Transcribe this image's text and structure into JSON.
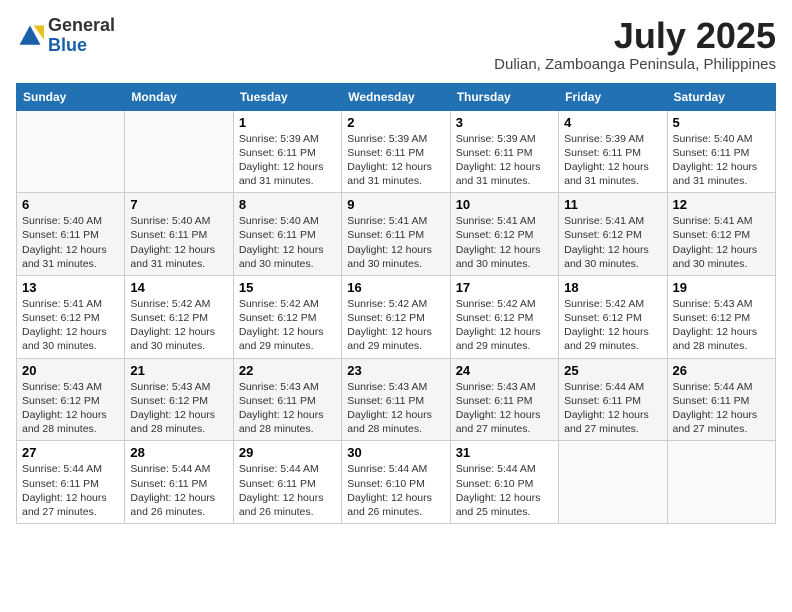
{
  "logo": {
    "general": "General",
    "blue": "Blue"
  },
  "header": {
    "month": "July 2025",
    "location": "Dulian, Zamboanga Peninsula, Philippines"
  },
  "weekdays": [
    "Sunday",
    "Monday",
    "Tuesday",
    "Wednesday",
    "Thursday",
    "Friday",
    "Saturday"
  ],
  "weeks": [
    [
      {
        "day": "",
        "info": ""
      },
      {
        "day": "",
        "info": ""
      },
      {
        "day": "1",
        "info": "Sunrise: 5:39 AM\nSunset: 6:11 PM\nDaylight: 12 hours and 31 minutes."
      },
      {
        "day": "2",
        "info": "Sunrise: 5:39 AM\nSunset: 6:11 PM\nDaylight: 12 hours and 31 minutes."
      },
      {
        "day": "3",
        "info": "Sunrise: 5:39 AM\nSunset: 6:11 PM\nDaylight: 12 hours and 31 minutes."
      },
      {
        "day": "4",
        "info": "Sunrise: 5:39 AM\nSunset: 6:11 PM\nDaylight: 12 hours and 31 minutes."
      },
      {
        "day": "5",
        "info": "Sunrise: 5:40 AM\nSunset: 6:11 PM\nDaylight: 12 hours and 31 minutes."
      }
    ],
    [
      {
        "day": "6",
        "info": "Sunrise: 5:40 AM\nSunset: 6:11 PM\nDaylight: 12 hours and 31 minutes."
      },
      {
        "day": "7",
        "info": "Sunrise: 5:40 AM\nSunset: 6:11 PM\nDaylight: 12 hours and 31 minutes."
      },
      {
        "day": "8",
        "info": "Sunrise: 5:40 AM\nSunset: 6:11 PM\nDaylight: 12 hours and 30 minutes."
      },
      {
        "day": "9",
        "info": "Sunrise: 5:41 AM\nSunset: 6:11 PM\nDaylight: 12 hours and 30 minutes."
      },
      {
        "day": "10",
        "info": "Sunrise: 5:41 AM\nSunset: 6:12 PM\nDaylight: 12 hours and 30 minutes."
      },
      {
        "day": "11",
        "info": "Sunrise: 5:41 AM\nSunset: 6:12 PM\nDaylight: 12 hours and 30 minutes."
      },
      {
        "day": "12",
        "info": "Sunrise: 5:41 AM\nSunset: 6:12 PM\nDaylight: 12 hours and 30 minutes."
      }
    ],
    [
      {
        "day": "13",
        "info": "Sunrise: 5:41 AM\nSunset: 6:12 PM\nDaylight: 12 hours and 30 minutes."
      },
      {
        "day": "14",
        "info": "Sunrise: 5:42 AM\nSunset: 6:12 PM\nDaylight: 12 hours and 30 minutes."
      },
      {
        "day": "15",
        "info": "Sunrise: 5:42 AM\nSunset: 6:12 PM\nDaylight: 12 hours and 29 minutes."
      },
      {
        "day": "16",
        "info": "Sunrise: 5:42 AM\nSunset: 6:12 PM\nDaylight: 12 hours and 29 minutes."
      },
      {
        "day": "17",
        "info": "Sunrise: 5:42 AM\nSunset: 6:12 PM\nDaylight: 12 hours and 29 minutes."
      },
      {
        "day": "18",
        "info": "Sunrise: 5:42 AM\nSunset: 6:12 PM\nDaylight: 12 hours and 29 minutes."
      },
      {
        "day": "19",
        "info": "Sunrise: 5:43 AM\nSunset: 6:12 PM\nDaylight: 12 hours and 28 minutes."
      }
    ],
    [
      {
        "day": "20",
        "info": "Sunrise: 5:43 AM\nSunset: 6:12 PM\nDaylight: 12 hours and 28 minutes."
      },
      {
        "day": "21",
        "info": "Sunrise: 5:43 AM\nSunset: 6:12 PM\nDaylight: 12 hours and 28 minutes."
      },
      {
        "day": "22",
        "info": "Sunrise: 5:43 AM\nSunset: 6:11 PM\nDaylight: 12 hours and 28 minutes."
      },
      {
        "day": "23",
        "info": "Sunrise: 5:43 AM\nSunset: 6:11 PM\nDaylight: 12 hours and 28 minutes."
      },
      {
        "day": "24",
        "info": "Sunrise: 5:43 AM\nSunset: 6:11 PM\nDaylight: 12 hours and 27 minutes."
      },
      {
        "day": "25",
        "info": "Sunrise: 5:44 AM\nSunset: 6:11 PM\nDaylight: 12 hours and 27 minutes."
      },
      {
        "day": "26",
        "info": "Sunrise: 5:44 AM\nSunset: 6:11 PM\nDaylight: 12 hours and 27 minutes."
      }
    ],
    [
      {
        "day": "27",
        "info": "Sunrise: 5:44 AM\nSunset: 6:11 PM\nDaylight: 12 hours and 27 minutes."
      },
      {
        "day": "28",
        "info": "Sunrise: 5:44 AM\nSunset: 6:11 PM\nDaylight: 12 hours and 26 minutes."
      },
      {
        "day": "29",
        "info": "Sunrise: 5:44 AM\nSunset: 6:11 PM\nDaylight: 12 hours and 26 minutes."
      },
      {
        "day": "30",
        "info": "Sunrise: 5:44 AM\nSunset: 6:10 PM\nDaylight: 12 hours and 26 minutes."
      },
      {
        "day": "31",
        "info": "Sunrise: 5:44 AM\nSunset: 6:10 PM\nDaylight: 12 hours and 25 minutes."
      },
      {
        "day": "",
        "info": ""
      },
      {
        "day": "",
        "info": ""
      }
    ]
  ]
}
